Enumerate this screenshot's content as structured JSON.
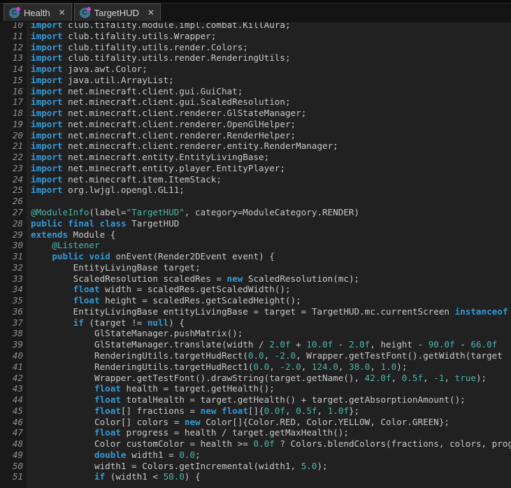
{
  "colors": {
    "bg": "#1e1e1e",
    "code-bg": "#212121",
    "gutter-bg": "#191919",
    "kw": "#3399d6",
    "lit": "#4ab6a9",
    "plain": "#c8c8c8",
    "lnum": "#8f8f8f",
    "tabbar": "#141414",
    "tab": "#2a2a2a",
    "tabborder": "#4a4a4a"
  },
  "tabbar": {
    "close_glyph": "✕",
    "tabs": [
      {
        "label": "Health",
        "icon": {
          "name": "class-icon",
          "letter": "C",
          "circle": "#3E7690",
          "dot": "#D240D2"
        }
      },
      {
        "label": "TargetHUD",
        "icon": {
          "name": "class-icon",
          "letter": "C",
          "circle": "#3E7690",
          "dot": "#D240D2"
        }
      }
    ]
  },
  "editor": {
    "language": "java",
    "lines": [
      {
        "n": 10,
        "t": [
          [
            "k",
            "import"
          ],
          [
            "p",
            " club.tifality.module.impl.combat.KillAura;"
          ]
        ]
      },
      {
        "n": 11,
        "t": [
          [
            "k",
            "import"
          ],
          [
            "p",
            " club.tifality.utils.Wrapper;"
          ]
        ]
      },
      {
        "n": 12,
        "t": [
          [
            "k",
            "import"
          ],
          [
            "p",
            " club.tifality.utils.render.Colors;"
          ]
        ]
      },
      {
        "n": 13,
        "t": [
          [
            "k",
            "import"
          ],
          [
            "p",
            " club.tifality.utils.render.RenderingUtils;"
          ]
        ]
      },
      {
        "n": 14,
        "t": [
          [
            "k",
            "import"
          ],
          [
            "p",
            " java.awt.Color;"
          ]
        ]
      },
      {
        "n": 15,
        "t": [
          [
            "k",
            "import"
          ],
          [
            "p",
            " java.util.ArrayList;"
          ]
        ]
      },
      {
        "n": 16,
        "t": [
          [
            "k",
            "import"
          ],
          [
            "p",
            " net.minecraft.client.gui.GuiChat;"
          ]
        ]
      },
      {
        "n": 17,
        "t": [
          [
            "k",
            "import"
          ],
          [
            "p",
            " net.minecraft.client.gui.ScaledResolution;"
          ]
        ]
      },
      {
        "n": 18,
        "t": [
          [
            "k",
            "import"
          ],
          [
            "p",
            " net.minecraft.client.renderer.GlStateManager;"
          ]
        ]
      },
      {
        "n": 19,
        "t": [
          [
            "k",
            "import"
          ],
          [
            "p",
            " net.minecraft.client.renderer.OpenGlHelper;"
          ]
        ]
      },
      {
        "n": 20,
        "t": [
          [
            "k",
            "import"
          ],
          [
            "p",
            " net.minecraft.client.renderer.RenderHelper;"
          ]
        ]
      },
      {
        "n": 21,
        "t": [
          [
            "k",
            "import"
          ],
          [
            "p",
            " net.minecraft.client.renderer.entity.RenderManager;"
          ]
        ]
      },
      {
        "n": 22,
        "t": [
          [
            "k",
            "import"
          ],
          [
            "p",
            " net.minecraft.entity.EntityLivingBase;"
          ]
        ]
      },
      {
        "n": 23,
        "t": [
          [
            "k",
            "import"
          ],
          [
            "p",
            " net.minecraft.entity.player.EntityPlayer;"
          ]
        ]
      },
      {
        "n": 24,
        "t": [
          [
            "k",
            "import"
          ],
          [
            "p",
            " net.minecraft.item.ItemStack;"
          ]
        ]
      },
      {
        "n": 25,
        "t": [
          [
            "k",
            "import"
          ],
          [
            "p",
            " org.lwjgl.opengl.GL11;"
          ]
        ]
      },
      {
        "n": 26,
        "t": []
      },
      {
        "n": 27,
        "t": [
          [
            "t",
            "@ModuleInfo"
          ],
          [
            "p",
            "(label="
          ],
          [
            "t",
            "\"TargetHUD\""
          ],
          [
            "p",
            ", category=ModuleCategory.RENDER)"
          ]
        ]
      },
      {
        "n": 28,
        "t": [
          [
            "k",
            "public"
          ],
          [
            "p",
            " "
          ],
          [
            "k",
            "final"
          ],
          [
            "p",
            " "
          ],
          [
            "k",
            "class"
          ],
          [
            "p",
            " TargetHUD"
          ]
        ]
      },
      {
        "n": 29,
        "t": [
          [
            "k",
            "extends"
          ],
          [
            "p",
            " Module {"
          ]
        ]
      },
      {
        "n": 30,
        "t": [
          [
            "p",
            "    "
          ],
          [
            "t",
            "@Listener"
          ]
        ]
      },
      {
        "n": 31,
        "t": [
          [
            "p",
            "    "
          ],
          [
            "k",
            "public"
          ],
          [
            "p",
            " "
          ],
          [
            "k",
            "void"
          ],
          [
            "p",
            " onEvent(Render2DEvent event) {"
          ]
        ]
      },
      {
        "n": 32,
        "t": [
          [
            "p",
            "        EntityLivingBase target;"
          ]
        ]
      },
      {
        "n": 33,
        "t": [
          [
            "p",
            "        ScaledResolution scaledRes = "
          ],
          [
            "k",
            "new"
          ],
          [
            "p",
            " ScaledResolution(mc);"
          ]
        ]
      },
      {
        "n": 34,
        "t": [
          [
            "p",
            "        "
          ],
          [
            "k",
            "float"
          ],
          [
            "p",
            " width = scaledRes.getScaledWidth();"
          ]
        ]
      },
      {
        "n": 35,
        "t": [
          [
            "p",
            "        "
          ],
          [
            "k",
            "float"
          ],
          [
            "p",
            " height = scaledRes.getScaledHeight();"
          ]
        ]
      },
      {
        "n": 36,
        "t": [
          [
            "p",
            "        EntityLivingBase entityLivingBase = target = TargetHUD.mc.currentScreen "
          ],
          [
            "k",
            "instanceof"
          ]
        ]
      },
      {
        "n": 37,
        "t": [
          [
            "p",
            "        "
          ],
          [
            "k",
            "if"
          ],
          [
            "p",
            " (target != "
          ],
          [
            "k",
            "null"
          ],
          [
            "p",
            ") {"
          ]
        ]
      },
      {
        "n": 38,
        "t": [
          [
            "p",
            "            GlStateManager.pushMatrix();"
          ]
        ]
      },
      {
        "n": 39,
        "t": [
          [
            "p",
            "            GlStateManager.translate(width / "
          ],
          [
            "t",
            "2.0f"
          ],
          [
            "p",
            " + "
          ],
          [
            "t",
            "10.0f"
          ],
          [
            "p",
            " - "
          ],
          [
            "t",
            "2.0f"
          ],
          [
            "p",
            ", height - "
          ],
          [
            "t",
            "90.0f"
          ],
          [
            "p",
            " - "
          ],
          [
            "t",
            "66.0f"
          ]
        ]
      },
      {
        "n": 40,
        "t": [
          [
            "p",
            "            RenderingUtils.targetHudRect("
          ],
          [
            "t",
            "0.0"
          ],
          [
            "p",
            ", "
          ],
          [
            "t",
            "-2.0"
          ],
          [
            "p",
            ", Wrapper.getTestFont().getWidth(target"
          ]
        ]
      },
      {
        "n": 41,
        "t": [
          [
            "p",
            "            RenderingUtils.targetHudRect1("
          ],
          [
            "t",
            "0.0"
          ],
          [
            "p",
            ", "
          ],
          [
            "t",
            "-2.0"
          ],
          [
            "p",
            ", "
          ],
          [
            "t",
            "124.0"
          ],
          [
            "p",
            ", "
          ],
          [
            "t",
            "38.0"
          ],
          [
            "p",
            ", "
          ],
          [
            "t",
            "1.0"
          ],
          [
            "p",
            ");"
          ]
        ]
      },
      {
        "n": 42,
        "t": [
          [
            "p",
            "            Wrapper.getTestFont().drawString(target.getName(), "
          ],
          [
            "t",
            "42.0f"
          ],
          [
            "p",
            ", "
          ],
          [
            "t",
            "0.5f"
          ],
          [
            "p",
            ", "
          ],
          [
            "t",
            "-1"
          ],
          [
            "p",
            ", "
          ],
          [
            "t",
            "true"
          ],
          [
            "p",
            ");"
          ]
        ]
      },
      {
        "n": 43,
        "t": [
          [
            "p",
            "            "
          ],
          [
            "k",
            "float"
          ],
          [
            "p",
            " health = target.getHealth();"
          ]
        ]
      },
      {
        "n": 44,
        "t": [
          [
            "p",
            "            "
          ],
          [
            "k",
            "float"
          ],
          [
            "p",
            " totalHealth = target.getHealth() + target.getAbsorptionAmount();"
          ]
        ]
      },
      {
        "n": 45,
        "t": [
          [
            "p",
            "            "
          ],
          [
            "k",
            "float"
          ],
          [
            "p",
            "[] fractions = "
          ],
          [
            "k",
            "new"
          ],
          [
            "p",
            " "
          ],
          [
            "k",
            "float"
          ],
          [
            "p",
            "[]{"
          ],
          [
            "t",
            "0.0f"
          ],
          [
            "p",
            ", "
          ],
          [
            "t",
            "0.5f"
          ],
          [
            "p",
            ", "
          ],
          [
            "t",
            "1.0f"
          ],
          [
            "p",
            "};"
          ]
        ]
      },
      {
        "n": 46,
        "t": [
          [
            "p",
            "            Color[] colors = "
          ],
          [
            "k",
            "new"
          ],
          [
            "p",
            " Color[]{Color.RED, Color.YELLOW, Color.GREEN};"
          ]
        ]
      },
      {
        "n": 47,
        "t": [
          [
            "p",
            "            "
          ],
          [
            "k",
            "float"
          ],
          [
            "p",
            " progress = health / target.getMaxHealth();"
          ]
        ]
      },
      {
        "n": 48,
        "t": [
          [
            "p",
            "            Color customColor = health >= "
          ],
          [
            "t",
            "0.0f"
          ],
          [
            "p",
            " ? Colors.blendColors(fractions, colors, progress"
          ]
        ]
      },
      {
        "n": 49,
        "t": [
          [
            "p",
            "            "
          ],
          [
            "k",
            "double"
          ],
          [
            "p",
            " width1 = "
          ],
          [
            "t",
            "0.0"
          ],
          [
            "p",
            ";"
          ]
        ]
      },
      {
        "n": 50,
        "t": [
          [
            "p",
            "            width1 = Colors.getIncremental(width1, "
          ],
          [
            "t",
            "5.0"
          ],
          [
            "p",
            ");"
          ]
        ]
      },
      {
        "n": 51,
        "t": [
          [
            "p",
            "            "
          ],
          [
            "k",
            "if"
          ],
          [
            "p",
            " (width1 < "
          ],
          [
            "t",
            "50.0"
          ],
          [
            "p",
            ") {"
          ]
        ]
      }
    ]
  }
}
